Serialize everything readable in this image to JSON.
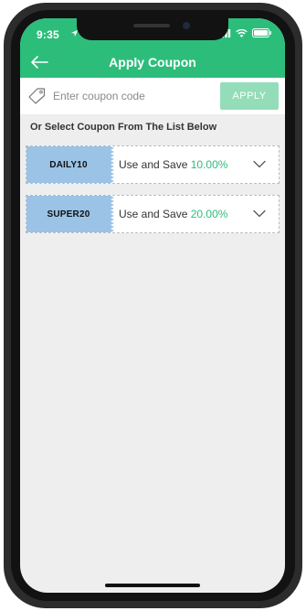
{
  "status_bar": {
    "time": "9:35"
  },
  "header": {
    "title": "Apply Coupon"
  },
  "coupon_entry": {
    "placeholder": "Enter coupon code",
    "value": "",
    "apply_label": "APPLY"
  },
  "list_heading": "Or Select Coupon From The List Below",
  "coupons": [
    {
      "code": "DAILY10",
      "desc": "Use and Save",
      "discount": "10.00%"
    },
    {
      "code": "SUPER20",
      "desc": "Use and Save",
      "discount": "20.00%"
    }
  ],
  "colors": {
    "accent": "#2dbd7b",
    "apply_button": "#93ddb9",
    "coupon_code_bg": "#9ac3e6",
    "screen_bg": "#eeeeee"
  },
  "icons": {
    "back": "arrow-left-icon",
    "location": "location-arrow-icon",
    "signal": "signal-icon",
    "wifi": "wifi-icon",
    "battery": "battery-icon",
    "tag": "tag-icon",
    "expand": "chevron-down-icon"
  }
}
